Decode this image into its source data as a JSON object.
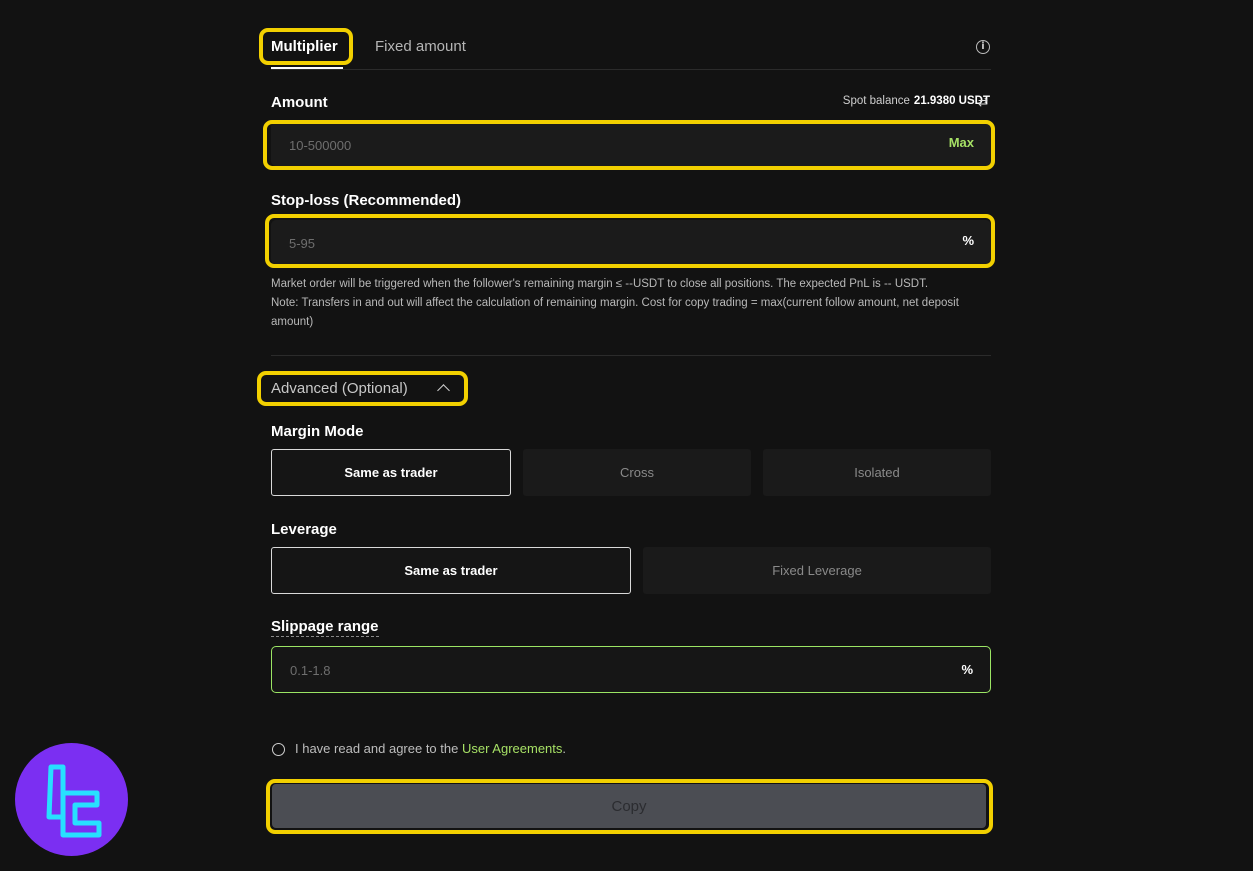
{
  "tabs": [
    {
      "label": "Multiplier",
      "active": true
    },
    {
      "label": "Fixed amount",
      "active": false
    }
  ],
  "info_icon": "info-icon",
  "amount": {
    "label": "Amount",
    "spot_balance_label": "Spot balance",
    "spot_balance_value": "21.9380 USDT",
    "placeholder": "10-500000",
    "max_label": "Max"
  },
  "stop_loss": {
    "label": "Stop-loss (Recommended)",
    "placeholder": "5-95",
    "unit": "%",
    "note_line1": "Market order will be triggered when the follower's remaining margin ≤ --USDT to close all positions. The expected PnL is -- USDT.",
    "note_line2": "Note: Transfers in and out will affect the calculation of remaining margin. Cost for copy trading = max(current follow amount, net deposit amount)"
  },
  "advanced": {
    "label": "Advanced (Optional)",
    "expanded": true
  },
  "margin_mode": {
    "label": "Margin Mode",
    "options": [
      "Same as trader",
      "Cross",
      "Isolated"
    ],
    "selected": "Same as trader"
  },
  "leverage": {
    "label": "Leverage",
    "options": [
      "Same as trader",
      "Fixed Leverage"
    ],
    "selected": "Same as trader"
  },
  "slippage": {
    "label": "Slippage range",
    "placeholder": "0.1-1.8",
    "unit": "%"
  },
  "agreement": {
    "text": "I have read and agree to the ",
    "link": "User Agreements",
    "suffix": "."
  },
  "copy_button": "Copy",
  "colors": {
    "background": "#121212",
    "accent_green": "#a6e065",
    "highlight_yellow": "#f2d000",
    "logo_purple": "#7b2ff2",
    "logo_cyan": "#27e0ff"
  }
}
